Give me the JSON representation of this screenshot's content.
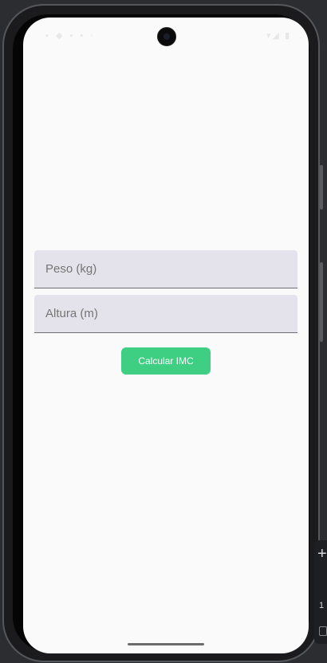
{
  "form": {
    "weight_placeholder": "Peso (kg)",
    "height_placeholder": "Altura (m)",
    "calculate_label": "Calcular IMC"
  },
  "colors": {
    "accent": "#3ecf82",
    "field_background": "#e4e3ec",
    "screen_background": "#fafafa"
  },
  "icons": {
    "status_left": [
      "notification-icon",
      "settings-icon",
      "storage-icon",
      "sync-icon"
    ],
    "status_right": [
      "wifi-icon",
      "signal-icon",
      "battery-icon"
    ],
    "edge": [
      "plus-icon"
    ]
  },
  "edge_panel": {
    "number_fragment": "1"
  }
}
